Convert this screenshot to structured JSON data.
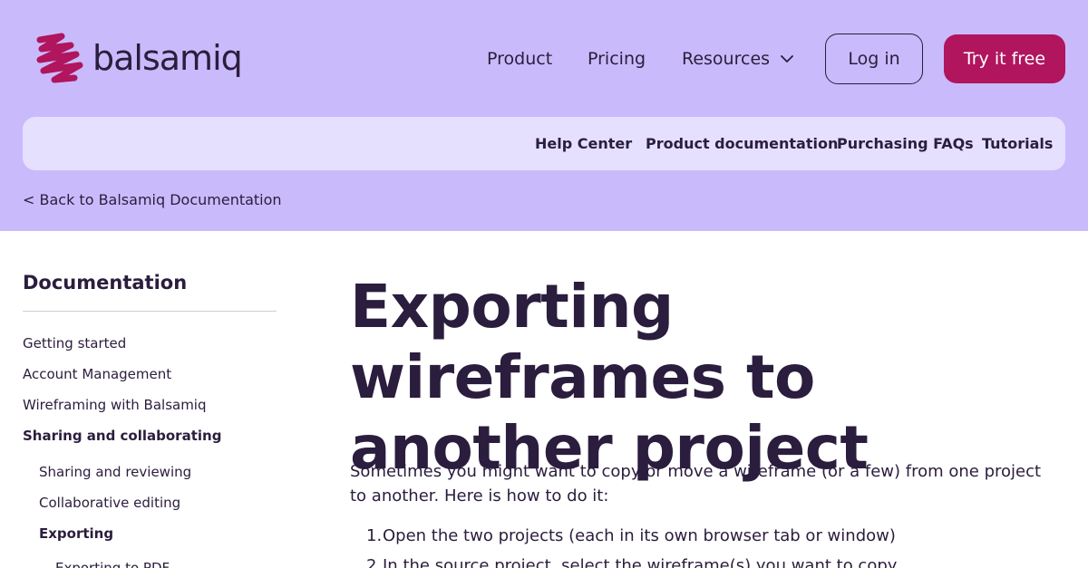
{
  "brand": {
    "name": "balsamiq",
    "logo_icon": "squiggle-logo-icon",
    "logo_color": "#b0155e"
  },
  "nav": {
    "product": "Product",
    "pricing": "Pricing",
    "resources": "Resources",
    "resources_icon": "chevron-down-icon",
    "login": "Log in",
    "try_free": "Try it free"
  },
  "subnav": {
    "help_center": "Help Center",
    "product_docs": "Product documentation",
    "purchasing_faqs": "Purchasing FAQs",
    "tutorials": "Tutorials"
  },
  "back_link": "< Back to Balsamiq Documentation",
  "sidebar": {
    "title": "Documentation",
    "items": [
      "Getting started",
      "Account Management",
      "Wireframing with Balsamiq",
      "Sharing and collaborating",
      "Sharing and reviewing",
      "Collaborative editing",
      "Exporting",
      "Exporting to PDF"
    ]
  },
  "article": {
    "title": "Exporting wireframes to another project",
    "intro": "Sometimes you might want to copy or move a wireframe (or a few) from one project to another. Here is how to do it:",
    "steps": [
      {
        "num": "1.",
        "text": "Open the two projects (each in its own browser tab or window)"
      },
      {
        "num": "2.",
        "text": "In the source project, select the wireframe(s) you want to copy"
      }
    ]
  },
  "colors": {
    "header_bg": "#c9bbfb",
    "subnav_bg": "#e6e0ff",
    "accent": "#b0155e",
    "text": "#2b1d3d"
  }
}
